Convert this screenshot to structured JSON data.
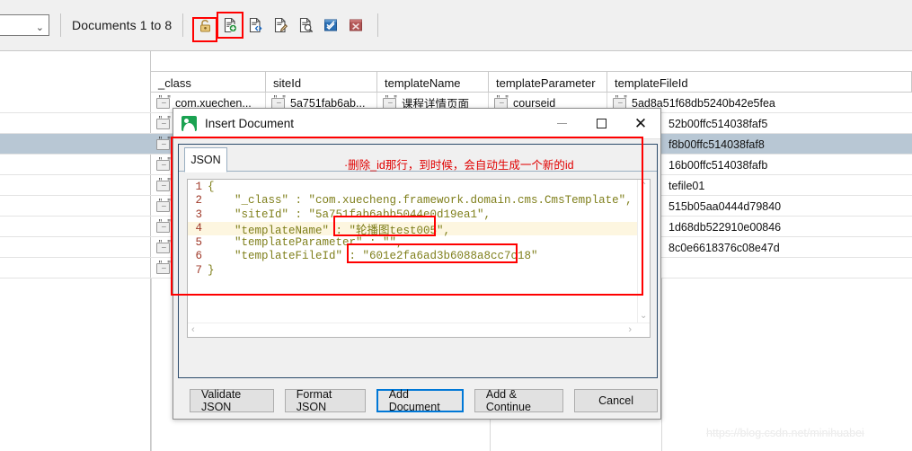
{
  "toolbar": {
    "combo_value": "",
    "documents_label": "Documents 1 to 8",
    "icons": [
      {
        "name": "lock-icon",
        "title": "Lock"
      },
      {
        "name": "add-document-icon",
        "title": "Insert Document"
      },
      {
        "name": "document-code-icon",
        "title": "View Source"
      },
      {
        "name": "edit-document-icon",
        "title": "Edit Document"
      },
      {
        "name": "find-document-icon",
        "title": "Find Document"
      },
      {
        "name": "confirm-blue-icon",
        "title": "Confirm"
      },
      {
        "name": "delete-red-icon",
        "title": "Delete"
      }
    ]
  },
  "grid": {
    "columns": [
      "_class",
      "siteId",
      "templateName",
      "templateParameter",
      "templateFileId"
    ],
    "first_row": {
      "_class": "com.xuechen...",
      "siteId": "5a751fab6ab...",
      "templateName": "课程详情页面",
      "templateParameter": "courseid",
      "templateFileId": "5ad8a51f68db5240b42e5fea"
    },
    "background_values": [
      "52b00ffc514038faf5",
      "f8b00ffc514038faf8",
      "16b00ffc514038fafb",
      "tefile01",
      "515b05aa0444d79840",
      "1d68db522910e00846",
      "8c0e6618376c08e47d"
    ],
    "selected_row_index": 1
  },
  "dialog": {
    "title": "Insert Document",
    "window_buttons": {
      "minimize": "minimize-icon",
      "maximize": "maximize-icon",
      "close": "close-icon"
    },
    "tab": "JSON",
    "code_lines": [
      {
        "n": "1",
        "text": "{"
      },
      {
        "n": "2",
        "text": "    \"_class\" : \"com.xuecheng.framework.domain.cms.CmsTemplate\","
      },
      {
        "n": "3",
        "text": "    \"siteId\" : \"5a751fab6abb5044e0d19ea1\","
      },
      {
        "n": "4",
        "text": "    \"templateName\" : \"轮播图test005\","
      },
      {
        "n": "5",
        "text": "    \"templateParameter\" : \"\","
      },
      {
        "n": "6",
        "text": "    \"templateFileId\" : \"601e2fa6ad3b6088a8cc7c18\""
      },
      {
        "n": "7",
        "text": "}"
      }
    ],
    "highlighted_line": 3,
    "buttons": [
      {
        "label": "Validate JSON",
        "primary": false
      },
      {
        "label": "Format JSON",
        "primary": false
      },
      {
        "label": "Add Document",
        "primary": true
      },
      {
        "label": "Add & Continue",
        "primary": false
      },
      {
        "label": "Cancel",
        "primary": false
      }
    ],
    "scroll_arrows": {
      "up": "⌃",
      "down": "⌄",
      "left": "‹",
      "right": "›"
    }
  },
  "annotation": {
    "text": "·删除_id那行，到时候，会自动生成一个新的id",
    "color": "#ff0000"
  },
  "watermark": "https://blog.csdn.net/minihuabei",
  "colors": {
    "accent_blue": "#0078d7",
    "annotation_red": "#ff0000",
    "selected_row": "#b8c7d4",
    "json_key": "#7f7f1b",
    "line_number": "#a03a2a",
    "app_green": "#1aa251"
  }
}
